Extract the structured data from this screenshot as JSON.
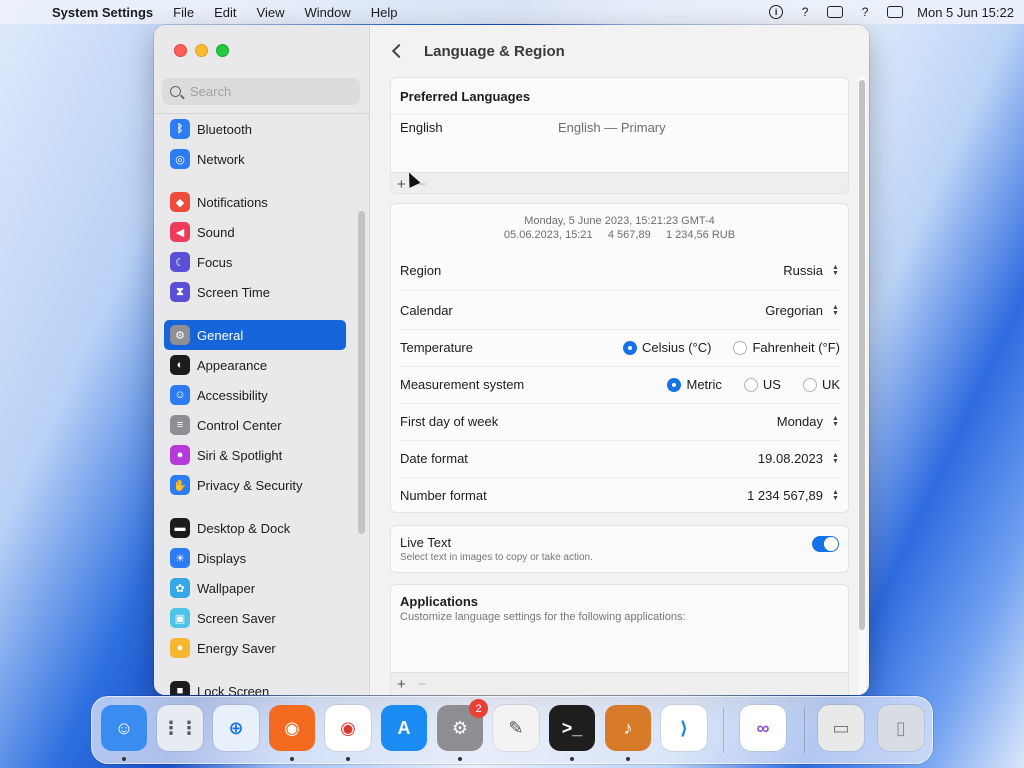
{
  "menubar": {
    "app_name": "System Settings",
    "menus": [
      "File",
      "Edit",
      "View",
      "Window",
      "Help"
    ],
    "clock": "Mon 5 Jun  15:22"
  },
  "sidebar": {
    "search_placeholder": "Search",
    "groups": [
      [
        {
          "label": "Bluetooth",
          "icon": "bluetooth-icon",
          "color": "#2d7cf6"
        },
        {
          "label": "Network",
          "icon": "globe-icon",
          "color": "#2d7cf6"
        }
      ],
      [
        {
          "label": "Notifications",
          "icon": "bell-icon",
          "color": "#ef4a3b"
        },
        {
          "label": "Sound",
          "icon": "speaker-icon",
          "color": "#ef3b5a"
        },
        {
          "label": "Focus",
          "icon": "moon-icon",
          "color": "#5a4fd6"
        },
        {
          "label": "Screen Time",
          "icon": "hourglass-icon",
          "color": "#5a4fd6"
        }
      ],
      [
        {
          "label": "General",
          "icon": "gear-icon",
          "color": "#8e8e93",
          "active": true
        },
        {
          "label": "Appearance",
          "icon": "appearance-icon",
          "color": "#1c1c1e"
        },
        {
          "label": "Accessibility",
          "icon": "accessibility-icon",
          "color": "#2d7cf6"
        },
        {
          "label": "Control Center",
          "icon": "control-center-icon",
          "color": "#8e8e93"
        },
        {
          "label": "Siri & Spotlight",
          "icon": "siri-icon",
          "color": "#b63ad8"
        },
        {
          "label": "Privacy & Security",
          "icon": "hand-icon",
          "color": "#2d7cf6"
        }
      ],
      [
        {
          "label": "Desktop & Dock",
          "icon": "dock-icon",
          "color": "#1c1c1e"
        },
        {
          "label": "Displays",
          "icon": "sun-icon",
          "color": "#2d7cf6"
        },
        {
          "label": "Wallpaper",
          "icon": "flower-icon",
          "color": "#35a8e8"
        },
        {
          "label": "Screen Saver",
          "icon": "screen-saver-icon",
          "color": "#4fc3e8"
        },
        {
          "label": "Energy Saver",
          "icon": "bulb-icon",
          "color": "#f5b82e"
        }
      ],
      [
        {
          "label": "Lock Screen",
          "icon": "lock-icon",
          "color": "#1c1c1e"
        }
      ]
    ]
  },
  "main": {
    "title": "Language & Region",
    "preferred": {
      "title": "Preferred Languages",
      "language": "English",
      "language_desc": "English — Primary",
      "add": "+",
      "remove": "−"
    },
    "preview": {
      "line1": "Monday, 5 June 2023, 15:21:23 GMT-4",
      "line2": "05.06.2023, 15:21     4 567,89     1 234,56 RUB"
    },
    "rows": {
      "region": {
        "label": "Region",
        "value": "Russia"
      },
      "calendar": {
        "label": "Calendar",
        "value": "Gregorian"
      },
      "temperature": {
        "label": "Temperature",
        "opt1": "Celsius (°C)",
        "opt2": "Fahrenheit (°F)",
        "selected": "Celsius (°C)"
      },
      "measurement": {
        "label": "Measurement system",
        "opt1": "Metric",
        "opt2": "US",
        "opt3": "UK",
        "selected": "Metric"
      },
      "first_day": {
        "label": "First day of week",
        "value": "Monday"
      },
      "date_format": {
        "label": "Date format",
        "value": "19.08.2023"
      },
      "number_format": {
        "label": "Number format",
        "value": "1 234 567,89"
      }
    },
    "live_text": {
      "title": "Live Text",
      "subtitle": "Select text in images to copy or take action.",
      "enabled": true
    },
    "applications": {
      "title": "Applications",
      "subtitle": "Customize language settings for the following applications:",
      "add": "+",
      "remove": "−"
    }
  },
  "dock": {
    "apps": [
      {
        "name": "Finder",
        "icon": "finder-icon",
        "color": "#3b8cf0",
        "running": true
      },
      {
        "name": "Launchpad",
        "icon": "launchpad-icon",
        "color": "#e8ecf2"
      },
      {
        "name": "Safari",
        "icon": "safari-icon",
        "color": "#e8f0fb"
      },
      {
        "name": "Firefox",
        "icon": "firefox-icon",
        "color": "#f46a1f",
        "running": true
      },
      {
        "name": "Chrome",
        "icon": "chrome-icon",
        "color": "#ffffff",
        "running": true
      },
      {
        "name": "App Store",
        "icon": "app-store-icon",
        "color": "#1b8cf3"
      },
      {
        "name": "System Settings",
        "icon": "system-settings-icon",
        "color": "#8d8d92",
        "running": true,
        "badge": "2"
      },
      {
        "name": "TextEdit",
        "icon": "textedit-icon",
        "color": "#f3f3f3"
      },
      {
        "name": "Terminal",
        "icon": "terminal-icon",
        "color": "#1e1e1e",
        "running": true
      },
      {
        "name": "GarageBand",
        "icon": "garageband-icon",
        "color": "#d77b28",
        "running": true
      },
      {
        "name": "Visual Studio Code",
        "icon": "vscode-icon",
        "color": "#ffffff"
      },
      {
        "name": "Visual Studio",
        "icon": "visual-studio-icon",
        "color": "#ffffff"
      },
      {
        "name": "Preview",
        "icon": "preview-icon",
        "color": "#e9e9e9"
      },
      {
        "name": "Trash",
        "icon": "trash-icon",
        "color": "#d8dde4"
      }
    ]
  }
}
